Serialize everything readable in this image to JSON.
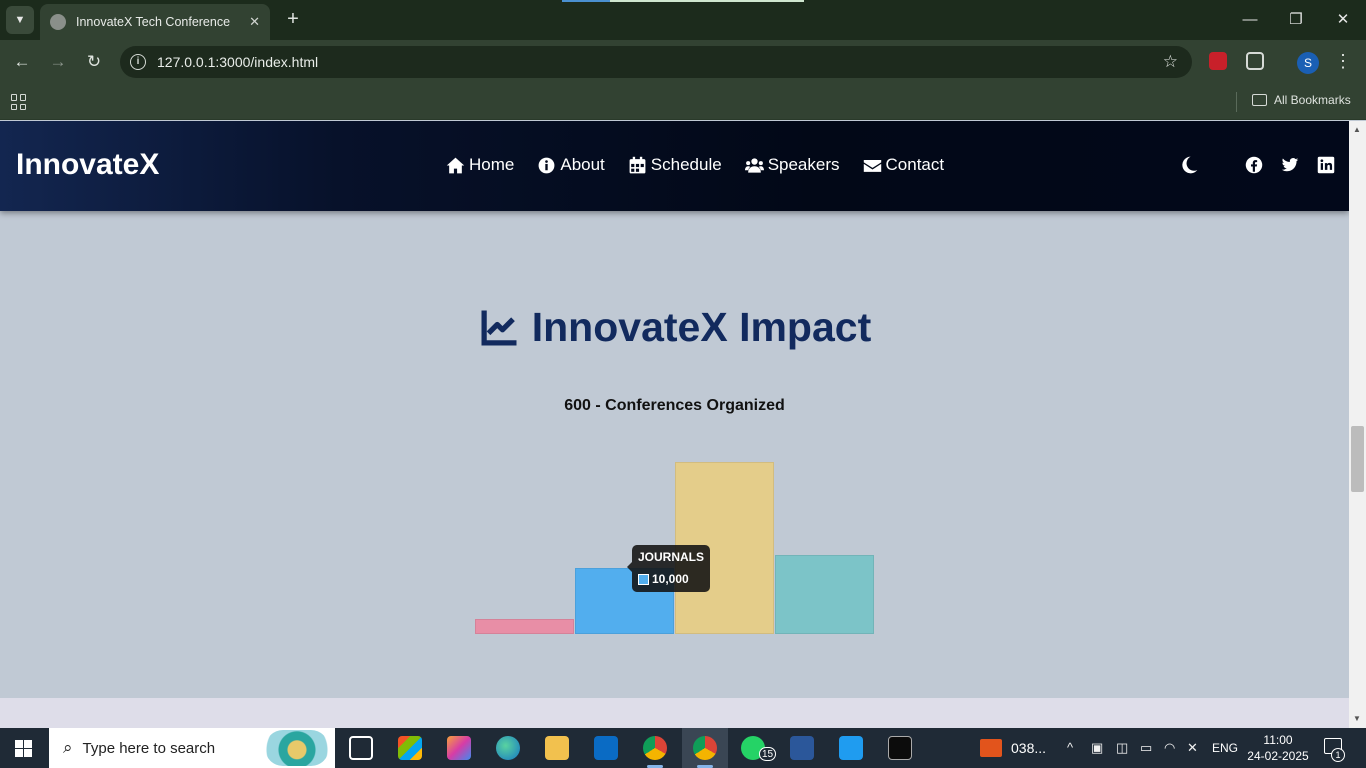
{
  "browser": {
    "tab_title": "InnovateX Tech Conference",
    "url": "127.0.0.1:3000/index.html",
    "profile_initial": "S",
    "bookmarks_label": "All Bookmarks"
  },
  "site": {
    "brand": "InnovateX",
    "nav": [
      {
        "label": "Home",
        "icon": "home-icon"
      },
      {
        "label": "About",
        "icon": "info-icon"
      },
      {
        "label": "Schedule",
        "icon": "calendar-icon"
      },
      {
        "label": "Speakers",
        "icon": "users-icon"
      },
      {
        "label": "Contact",
        "icon": "envelope-icon"
      }
    ],
    "theme_toggle_icon": "moon-icon",
    "social_icons": [
      "facebook-icon",
      "twitter-icon",
      "linkedin-icon"
    ]
  },
  "impact": {
    "title": "InnovateX Impact",
    "title_icon": "chart-line-icon",
    "caption": "600 - Conferences Organized"
  },
  "chart_data": {
    "type": "bar",
    "title": "",
    "xlabel": "",
    "ylabel": "",
    "categories": [
      "",
      "JOURNALS",
      "",
      ""
    ],
    "values": [
      2300,
      10000,
      26000,
      12000
    ],
    "colors": [
      "#e88ea6",
      "#52aeee",
      "#e4cd8a",
      "#7cc4c8"
    ],
    "ylim": [
      0,
      26000
    ],
    "grid": false,
    "legend": "none",
    "tooltip": {
      "label": "JOURNALS",
      "value": "10,000",
      "swatch_color": "#52aeee"
    }
  },
  "taskbar": {
    "search_placeholder": "Type here to search",
    "whatsapp_badge": "15",
    "tray_app_label": "038...",
    "language": "ENG",
    "time": "11:00",
    "date": "24-02-2025",
    "notification_count": "1"
  },
  "colors": {
    "nav_bg": "#02081a",
    "page_bg": "#c0c9d4",
    "title": "#122a5e"
  }
}
